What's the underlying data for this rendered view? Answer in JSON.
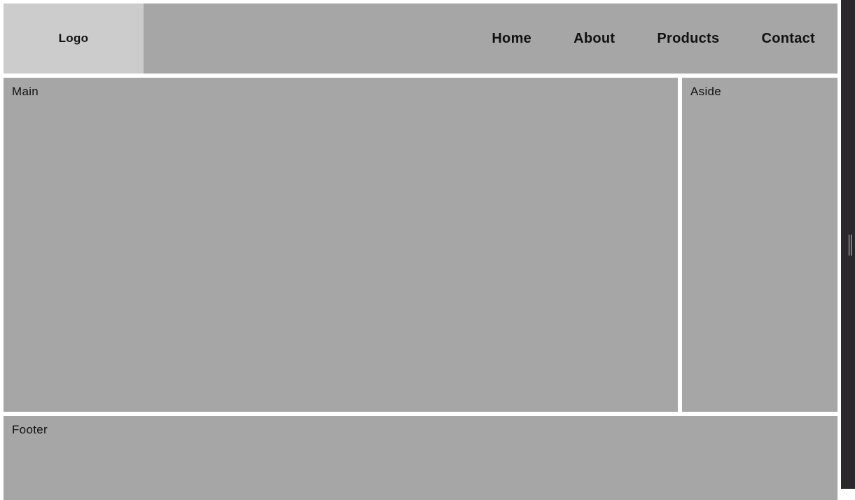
{
  "header": {
    "logo": "Logo",
    "nav": [
      {
        "label": "Home"
      },
      {
        "label": "About"
      },
      {
        "label": "Products"
      },
      {
        "label": "Contact"
      }
    ]
  },
  "main": {
    "label": "Main"
  },
  "aside": {
    "label": "Aside"
  },
  "footer": {
    "label": "Footer"
  }
}
